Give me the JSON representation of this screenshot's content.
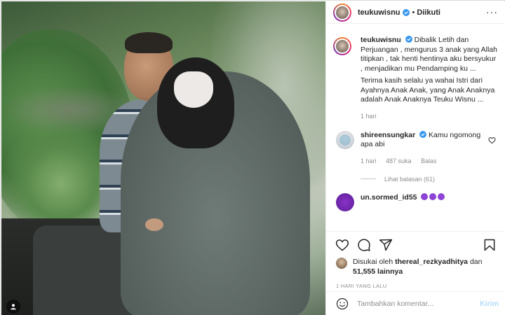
{
  "post": {
    "username": "teukuwisnu",
    "follow_status": "Diikuti",
    "separator": "•"
  },
  "caption": {
    "username": "teukuwisnu",
    "paragraph1": "Dibalik Letih dan Perjuangan , mengurus 3 anak yang Allah titipkan , tak henti hentinya aku bersyukur , menjadikan mu Pendamping ku ...",
    "paragraph2": "Terima kasih selalu ya wahai Istri dari Ayahnya Anak Anak, yang Anak Anaknya adalah Anak Anaknya Teuku Wisnu ...",
    "time": "1 hari"
  },
  "comments": [
    {
      "username": "shireensungkar",
      "text": "Kamu ngomong apa abi",
      "time": "1 hari",
      "likes": "487 suka",
      "reply_label": "Balas",
      "view_replies": "Lihat balasan (61)"
    }
  ],
  "next_comment_partial": "un.sormed_id55",
  "likes": {
    "prefix": "Disukai oleh",
    "user": "thereal_rezkyadhitya",
    "connector": "dan",
    "others": "51,555 lainnya"
  },
  "posted_time": "1 HARI YANG LALU",
  "add_comment": {
    "placeholder": "Tambahkan komentar...",
    "post_label": "Kirim"
  },
  "icons": {
    "verified": "verified-badge-icon",
    "more": "more-options-icon",
    "heart": "heart-icon",
    "comment": "comment-icon",
    "share": "share-icon",
    "save": "bookmark-icon",
    "emoji": "emoji-icon",
    "user_tag": "user-tag-icon"
  },
  "colors": {
    "accent_blue": "#0095f6",
    "post_disabled": "#b3dbff",
    "verified": "#3897f0"
  }
}
